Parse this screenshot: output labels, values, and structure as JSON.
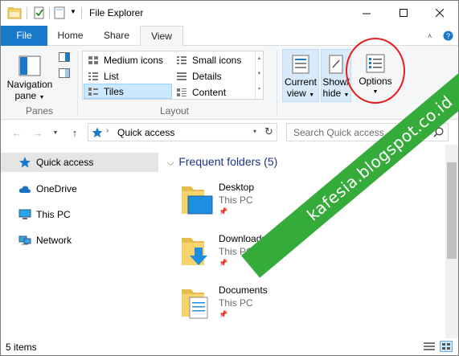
{
  "title_bar": {
    "title": "File Explorer"
  },
  "tabs": [
    {
      "label": "File"
    },
    {
      "label": "Home"
    },
    {
      "label": "Share"
    },
    {
      "label": "View"
    }
  ],
  "ribbon": {
    "panes": {
      "navigation_pane": "Navigation",
      "navigation_pane_2": "pane",
      "group_label": "Panes"
    },
    "layout": {
      "group_label": "Layout",
      "items": [
        {
          "label": "Medium icons"
        },
        {
          "label": "Small icons"
        },
        {
          "label": "List"
        },
        {
          "label": "Details"
        },
        {
          "label": "Tiles",
          "selected": true
        },
        {
          "label": "Content"
        }
      ]
    },
    "current_view": {
      "line1": "Current",
      "line2": "view"
    },
    "show_hide": {
      "line1": "Show/",
      "line2": "hide"
    },
    "options": {
      "label": "Options"
    }
  },
  "address": {
    "path": "Quick access",
    "search_placeholder": "Search Quick access"
  },
  "nav_pane": {
    "items": [
      {
        "label": "Quick access",
        "icon": "star-icon",
        "selected": true
      },
      {
        "label": "OneDrive",
        "icon": "cloud-icon"
      },
      {
        "label": "This PC",
        "icon": "computer-icon"
      },
      {
        "label": "Network",
        "icon": "network-icon"
      }
    ]
  },
  "content": {
    "section_title": "Frequent folders (5)",
    "folders": [
      {
        "name": "Desktop",
        "location": "This PC",
        "icon": "desktop-folder-icon"
      },
      {
        "name": "Downloads",
        "location": "This PC",
        "icon": "downloads-folder-icon"
      },
      {
        "name": "Documents",
        "location": "This PC",
        "icon": "documents-folder-icon"
      }
    ]
  },
  "status_bar": {
    "item_count": "5 items"
  },
  "watermark": {
    "text": "kafesia.blogspot.co.id"
  },
  "colors": {
    "file_tab": "#1979ca",
    "accent_folder": "#f6d46b",
    "watermark_green": "#35ab3a",
    "annotation_red": "#e21d1d",
    "header_blue": "#1e3287"
  }
}
